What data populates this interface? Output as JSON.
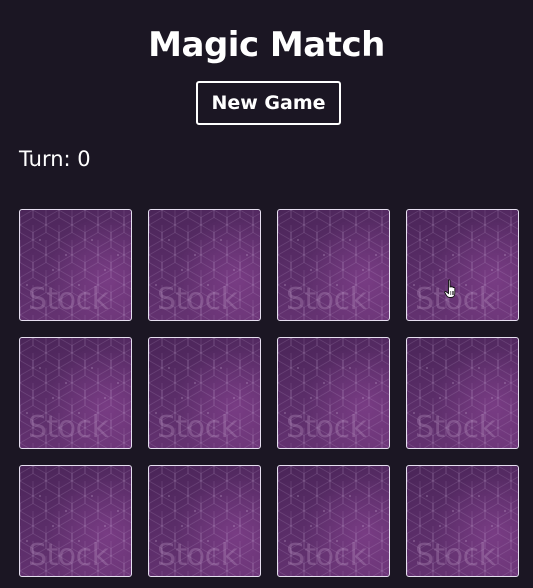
{
  "game": {
    "title": "Magic Match",
    "new_game_label": "New Game",
    "turn_text": "Turn: 0"
  },
  "board": {
    "rows": 3,
    "columns": 4,
    "card_back_watermark": "Stock",
    "cards": [
      {
        "state": "face-down"
      },
      {
        "state": "face-down"
      },
      {
        "state": "face-down"
      },
      {
        "state": "face-down"
      },
      {
        "state": "face-down"
      },
      {
        "state": "face-down"
      },
      {
        "state": "face-down"
      },
      {
        "state": "face-down"
      },
      {
        "state": "face-down"
      },
      {
        "state": "face-down"
      },
      {
        "state": "face-down"
      },
      {
        "state": "face-down"
      }
    ]
  },
  "colors": {
    "background": "#1b1623",
    "text": "#ffffff",
    "card_back": "#5a2d68",
    "card_border": "#e6dff0"
  },
  "icons": {
    "cursor": "hand-pointer-icon"
  }
}
